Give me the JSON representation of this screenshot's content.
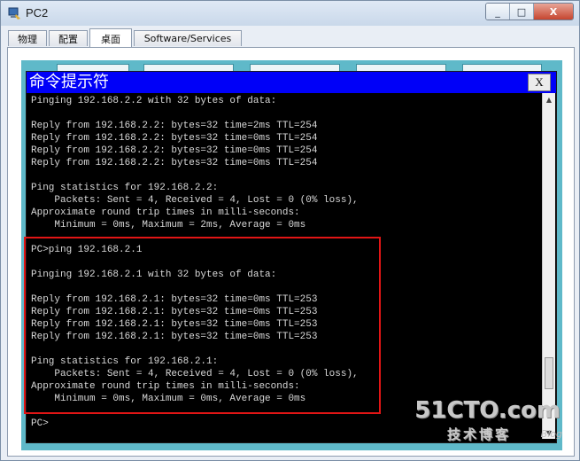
{
  "window": {
    "title": "PC2",
    "icon": "packet-tracer-pc-icon",
    "minimize_symbol": "_",
    "maximize_symbol": "□",
    "close_symbol": "X"
  },
  "tabs": [
    {
      "label": "物理"
    },
    {
      "label": "配置"
    },
    {
      "label": "桌面"
    },
    {
      "label": "Software/Services"
    }
  ],
  "command_prompt": {
    "title": "命令提示符",
    "close_label": "X",
    "lines": [
      "Pinging 192.168.2.2 with 32 bytes of data:",
      "",
      "Reply from 192.168.2.2: bytes=32 time=2ms TTL=254",
      "Reply from 192.168.2.2: bytes=32 time=0ms TTL=254",
      "Reply from 192.168.2.2: bytes=32 time=0ms TTL=254",
      "Reply from 192.168.2.2: bytes=32 time=0ms TTL=254",
      "",
      "Ping statistics for 192.168.2.2:",
      "    Packets: Sent = 4, Received = 4, Lost = 0 (0% loss),",
      "Approximate round trip times in milli-seconds:",
      "    Minimum = 0ms, Maximum = 2ms, Average = 0ms",
      "",
      "PC>ping 192.168.2.1",
      "",
      "Pinging 192.168.2.1 with 32 bytes of data:",
      "",
      "Reply from 192.168.2.1: bytes=32 time=0ms TTL=253",
      "Reply from 192.168.2.1: bytes=32 time=0ms TTL=253",
      "Reply from 192.168.2.1: bytes=32 time=0ms TTL=253",
      "Reply from 192.168.2.1: bytes=32 time=0ms TTL=253",
      "",
      "Ping statistics for 192.168.2.1:",
      "    Packets: Sent = 4, Received = 4, Lost = 0 (0% loss),",
      "Approximate round trip times in milli-seconds:",
      "    Minimum = 0ms, Maximum = 0ms, Average = 0ms",
      "",
      "PC>"
    ]
  },
  "watermark": {
    "brand": "51CTO.com",
    "subtitle": "技术博客",
    "tag": "Blog"
  },
  "colors": {
    "cmd_title_bg": "#0000f8",
    "desktop_bg": "#5fb9c9",
    "highlight_border": "#e11515"
  }
}
